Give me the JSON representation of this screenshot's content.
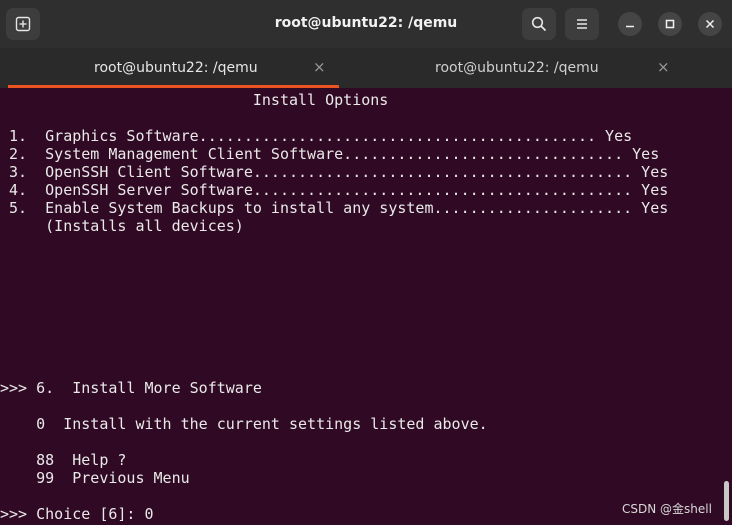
{
  "window": {
    "title": "root@ubuntu22: /qemu"
  },
  "header": {
    "new_tab_icon": "new-tab-icon",
    "search_icon": "search-icon",
    "menu_icon": "hamburger-menu-icon",
    "minimize_icon": "minimize-icon",
    "maximize_icon": "maximize-icon",
    "close_icon": "close-icon"
  },
  "tabs": [
    {
      "label": "root@ubuntu22: /qemu",
      "close": "×",
      "active": true
    },
    {
      "label": "root@ubuntu22: /qemu",
      "close": "×",
      "active": false
    }
  ],
  "colors": {
    "terminal_bg": "#300a24",
    "header_bg": "#2f2f2f",
    "accent": "#e95420",
    "text": "#e9e9e9"
  },
  "terminal": {
    "lines": [
      "                            Install Options",
      "",
      " 1.  Graphics Software............................................ Yes",
      " 2.  System Management Client Software............................... Yes",
      " 3.  OpenSSH Client Software.......................................... Yes",
      " 4.  OpenSSH Server Software.......................................... Yes",
      " 5.  Enable System Backups to install any system...................... Yes",
      "     (Installs all devices)",
      "",
      "",
      "",
      "",
      "",
      "",
      "",
      ">>> 6.  Install More Software",
      "",
      "    0  Install with the current settings listed above.",
      "",
      "    88  Help ?",
      "    99  Previous Menu",
      "",
      ">>> Choice [6]: 0"
    ]
  },
  "watermark": "CSDN @金shell"
}
